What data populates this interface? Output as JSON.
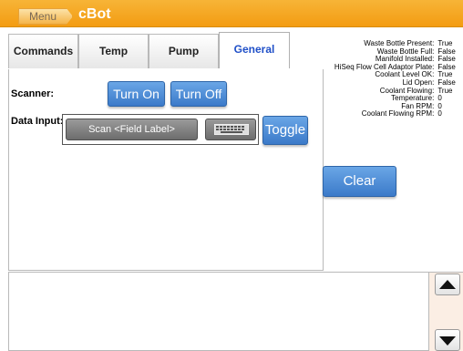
{
  "app": {
    "title": "cBot",
    "menu_label": "Menu"
  },
  "tabs": [
    {
      "label": "Commands",
      "active": false
    },
    {
      "label": "Temp",
      "active": false
    },
    {
      "label": "Pump",
      "active": false
    },
    {
      "label": "General",
      "active": true
    }
  ],
  "general": {
    "scanner_label": "Scanner:",
    "turn_on_label": "Turn On",
    "turn_off_label": "Turn Off",
    "data_input_label": "Data Input:",
    "scan_field_label": "Scan <Field Label>",
    "keyboard_icon": "keyboard-icon",
    "toggle_label": "Toggle"
  },
  "status": [
    {
      "key": "Waste Bottle Present:",
      "value": "True"
    },
    {
      "key": "Waste Bottle Full:",
      "value": "False"
    },
    {
      "key": "Manifold Installed:",
      "value": "False"
    },
    {
      "key": "HiSeq Flow Cell Adaptor Plate:",
      "value": "False"
    },
    {
      "key": "Coolant Level OK:",
      "value": "True"
    },
    {
      "key": "Lid Open:",
      "value": "False"
    },
    {
      "key": "Coolant Flowing:",
      "value": "True"
    },
    {
      "key": "Temperature:",
      "value": "0"
    },
    {
      "key": "Fan RPM:",
      "value": "0"
    },
    {
      "key": "Coolant Flowing RPM:",
      "value": "0"
    }
  ],
  "clear_label": "Clear",
  "log": {
    "text": ""
  },
  "colors": {
    "accent_orange": "#f39c12",
    "button_blue": "#3b7ac9",
    "active_tab_text": "#2050c8"
  }
}
